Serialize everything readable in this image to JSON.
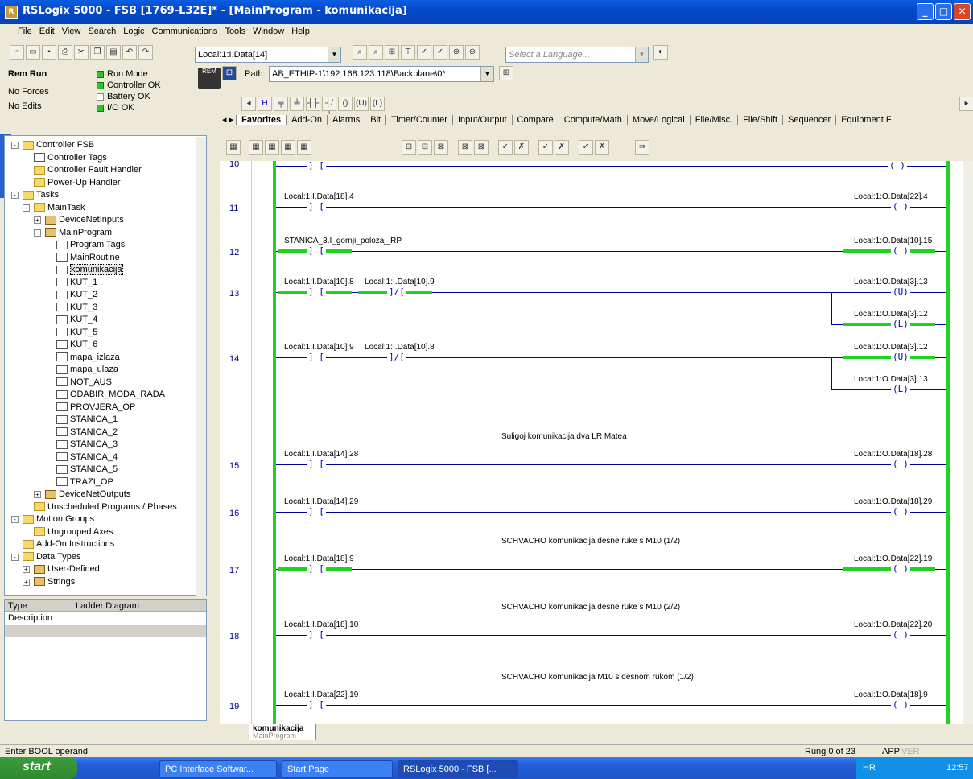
{
  "window": {
    "title": "RSLogix 5000 - FSB [1769-L32E]* - [MainProgram - komunikacija]"
  },
  "menu": [
    "File",
    "Edit",
    "View",
    "Search",
    "Logic",
    "Communications",
    "Tools",
    "Window",
    "Help"
  ],
  "toolbar": {
    "tag_combo": "Local:1:I.Data[14]",
    "language_placeholder": "Select a Language...",
    "path_label": "Path:",
    "path_value": "AB_ETHIP-1\\192.168.123.118\\Backplane\\0*"
  },
  "controller_status": {
    "mode": "Rem Run",
    "forces": "No Forces",
    "edits": "No Edits",
    "run_mode": "Run Mode",
    "controller_ok": "Controller OK",
    "battery_ok": "Battery OK",
    "io_ok": "I/O OK",
    "rem_badge": "REM"
  },
  "instr_tabs": [
    "Favorites",
    "Add-On",
    "Alarms",
    "Bit",
    "Timer/Counter",
    "Input/Output",
    "Compare",
    "Compute/Math",
    "Move/Logical",
    "File/Misc.",
    "File/Shift",
    "Sequencer",
    "Equipment F"
  ],
  "tree": [
    {
      "label": "Controller FSB",
      "lvl": 0,
      "icon": "folder",
      "exp": "-"
    },
    {
      "label": "Controller Tags",
      "lvl": 1,
      "icon": "doc"
    },
    {
      "label": "Controller Fault Handler",
      "lvl": 1,
      "icon": "folder"
    },
    {
      "label": "Power-Up Handler",
      "lvl": 1,
      "icon": "folder"
    },
    {
      "label": "Tasks",
      "lvl": 0,
      "icon": "folder",
      "exp": "-"
    },
    {
      "label": "MainTask",
      "lvl": 1,
      "icon": "folder",
      "exp": "-"
    },
    {
      "label": "DeviceNetInputs",
      "lvl": 2,
      "icon": "prog",
      "exp": "+"
    },
    {
      "label": "MainProgram",
      "lvl": 2,
      "icon": "prog",
      "exp": "-"
    },
    {
      "label": "Program Tags",
      "lvl": 3,
      "icon": "doc"
    },
    {
      "label": "MainRoutine",
      "lvl": 3,
      "icon": "doc"
    },
    {
      "label": "komunikacija",
      "lvl": 3,
      "icon": "doc",
      "sel": true
    },
    {
      "label": "KUT_1",
      "lvl": 3,
      "icon": "doc"
    },
    {
      "label": "KUT_2",
      "lvl": 3,
      "icon": "doc"
    },
    {
      "label": "KUT_3",
      "lvl": 3,
      "icon": "doc"
    },
    {
      "label": "KUT_4",
      "lvl": 3,
      "icon": "doc"
    },
    {
      "label": "KUT_5",
      "lvl": 3,
      "icon": "doc"
    },
    {
      "label": "KUT_6",
      "lvl": 3,
      "icon": "doc"
    },
    {
      "label": "mapa_izlaza",
      "lvl": 3,
      "icon": "doc"
    },
    {
      "label": "mapa_ulaza",
      "lvl": 3,
      "icon": "doc"
    },
    {
      "label": "NOT_AUS",
      "lvl": 3,
      "icon": "doc"
    },
    {
      "label": "ODABIR_MODA_RADA",
      "lvl": 3,
      "icon": "doc"
    },
    {
      "label": "PROVJERA_OP",
      "lvl": 3,
      "icon": "doc"
    },
    {
      "label": "STANICA_1",
      "lvl": 3,
      "icon": "doc"
    },
    {
      "label": "STANICA_2",
      "lvl": 3,
      "icon": "doc"
    },
    {
      "label": "STANICA_3",
      "lvl": 3,
      "icon": "doc"
    },
    {
      "label": "STANICA_4",
      "lvl": 3,
      "icon": "doc"
    },
    {
      "label": "STANICA_5",
      "lvl": 3,
      "icon": "doc"
    },
    {
      "label": "TRAZI_OP",
      "lvl": 3,
      "icon": "doc"
    },
    {
      "label": "DeviceNetOutputs",
      "lvl": 2,
      "icon": "prog",
      "exp": "+"
    },
    {
      "label": "Unscheduled Programs / Phases",
      "lvl": 1,
      "icon": "folder"
    },
    {
      "label": "Motion Groups",
      "lvl": 0,
      "icon": "folder",
      "exp": "-"
    },
    {
      "label": "Ungrouped Axes",
      "lvl": 1,
      "icon": "folder"
    },
    {
      "label": "Add-On Instructions",
      "lvl": 0,
      "icon": "folder"
    },
    {
      "label": "Data Types",
      "lvl": 0,
      "icon": "folder",
      "exp": "-"
    },
    {
      "label": "User-Defined",
      "lvl": 1,
      "icon": "prog",
      "exp": "+"
    },
    {
      "label": "Strings",
      "lvl": 1,
      "icon": "prog",
      "exp": "+"
    }
  ],
  "typebox": {
    "type_label": "Type",
    "type_value": "Ladder Diagram",
    "desc_label": "Description"
  },
  "rungs": [
    {
      "num": "11",
      "in": [
        {
          "tag": "Local:1:I.Data[18].4",
          "sym": "] [",
          "on": false
        }
      ],
      "out": [
        {
          "tag": "Local:1:O.Data[22].4",
          "sym": "( )",
          "on": false
        }
      ]
    },
    {
      "num": "12",
      "in": [
        {
          "tag": "STANICA_3.I_gornji_polozaj_RP",
          "sym": "] [",
          "on": true
        }
      ],
      "out": [
        {
          "tag": "Local:1:O.Data[10].15",
          "sym": "( )",
          "on": true
        }
      ]
    },
    {
      "num": "13",
      "in": [
        {
          "tag": "Local:1:I.Data[10].8",
          "sym": "] [",
          "on": true
        },
        {
          "tag": "Local:1:I.Data[10].9",
          "sym": "]/[",
          "on": true
        }
      ],
      "out": [
        {
          "tag": "Local:1:O.Data[3].13",
          "sym": "(U)",
          "on": false
        },
        {
          "tag": "Local:1:O.Data[3].12",
          "sym": "(L)",
          "on": true
        }
      ]
    },
    {
      "num": "14",
      "in": [
        {
          "tag": "Local:1:I.Data[10].9",
          "sym": "] [",
          "on": false
        },
        {
          "tag": "Local:1:I.Data[10].8",
          "sym": "]/[",
          "on": false
        }
      ],
      "out": [
        {
          "tag": "Local:1:O.Data[3].12",
          "sym": "(U)",
          "on": true
        },
        {
          "tag": "Local:1:O.Data[3].13",
          "sym": "(L)",
          "on": false
        }
      ]
    },
    {
      "num": "15",
      "comment": "Suligoj komunikacija dva LR Matea",
      "in": [
        {
          "tag": "Local:1:I.Data[14].28",
          "sym": "] [",
          "on": false
        }
      ],
      "out": [
        {
          "tag": "Local:1:O.Data[18].28",
          "sym": "( )",
          "on": false
        }
      ]
    },
    {
      "num": "16",
      "in": [
        {
          "tag": "Local:1:I.Data[14].29",
          "sym": "] [",
          "on": false
        }
      ],
      "out": [
        {
          "tag": "Local:1:O.Data[18].29",
          "sym": "( )",
          "on": false
        }
      ]
    },
    {
      "num": "17",
      "comment": "SCHVACHO komunikacija desne ruke s M10 (1/2)",
      "in": [
        {
          "tag": "Local:1:I.Data[18].9",
          "sym": "] [",
          "on": true
        }
      ],
      "out": [
        {
          "tag": "Local:1:O.Data[22].19",
          "sym": "( )",
          "on": true
        }
      ]
    },
    {
      "num": "18",
      "comment": "SCHVACHO komunikacija desne ruke s M10 (2/2)",
      "in": [
        {
          "tag": "Local:1:I.Data[18].10",
          "sym": "] [",
          "on": false
        }
      ],
      "out": [
        {
          "tag": "Local:1:O.Data[22].20",
          "sym": "( )",
          "on": false
        }
      ]
    },
    {
      "num": "19",
      "comment": "SCHVACHO komunikacija M10 s desnom rukom (1/2)",
      "in": [
        {
          "tag": "Local:1:I.Data[22].19",
          "sym": "] [",
          "on": false
        }
      ],
      "out": [
        {
          "tag": "Local:1:O.Data[18].9",
          "sym": "( )",
          "on": false
        }
      ]
    }
  ],
  "routine_tab": {
    "name": "komunikacija",
    "program": "MainProgram"
  },
  "statusbar": {
    "message": "Enter BOOL operand",
    "rung": "Rung 0 of 23",
    "app": "APP",
    "ver": "VER"
  },
  "taskbar": {
    "start": "start",
    "items": [
      "PC Interface Softwar...",
      "Start Page",
      "RSLogix 5000 - FSB [..."
    ],
    "clock": "12:57",
    "lang": "HR"
  },
  "colors": {
    "energized": "#21d321",
    "wire": "#0000a0"
  }
}
